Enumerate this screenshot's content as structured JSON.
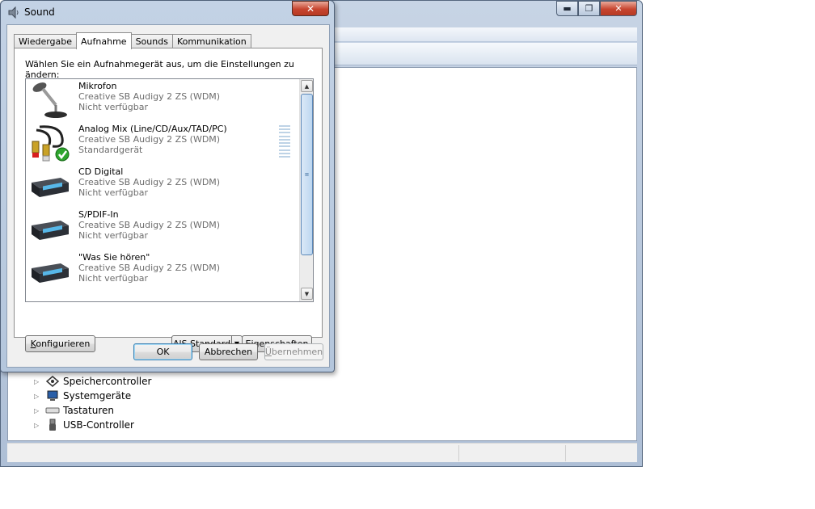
{
  "background_window": {
    "caption_buttons": {
      "minimize": "▬",
      "maximize": "❐",
      "close": "✕"
    },
    "tree_items": [
      {
        "label": "Speichercontroller",
        "icon": "storage-controller-icon"
      },
      {
        "label": "Systemgeräte",
        "icon": "system-devices-icon"
      },
      {
        "label": "Tastaturen",
        "icon": "keyboard-icon"
      },
      {
        "label": "USB-Controller",
        "icon": "usb-icon"
      }
    ]
  },
  "dialog": {
    "title": "Sound",
    "close_label": "✕",
    "tabs": [
      {
        "label": "Wiedergabe",
        "active": false
      },
      {
        "label": "Aufnahme",
        "active": true
      },
      {
        "label": "Sounds",
        "active": false
      },
      {
        "label": "Kommunikation",
        "active": false
      }
    ],
    "instruction": "Wählen Sie ein Aufnahmegerät aus, um die Einstellungen zu ändern:",
    "devices": [
      {
        "name": "Mikrofon",
        "driver": "Creative SB Audigy 2 ZS (WDM)",
        "status": "Nicht verfügbar",
        "icon": "microphone-icon"
      },
      {
        "name": "Analog Mix (Line/CD/Aux/TAD/PC)",
        "driver": "Creative SB Audigy 2 ZS (WDM)",
        "status": "Standardgerät",
        "icon": "cable-default-icon"
      },
      {
        "name": "CD Digital",
        "driver": "Creative SB Audigy 2 ZS (WDM)",
        "status": "Nicht verfügbar",
        "icon": "sound-device-icon"
      },
      {
        "name": "S/PDIF-In",
        "driver": "Creative SB Audigy 2 ZS (WDM)",
        "status": "Nicht verfügbar",
        "icon": "sound-device-icon"
      },
      {
        "name": "\"Was Sie hören\"",
        "driver": "Creative SB Audigy 2 ZS (WDM)",
        "status": "Nicht verfügbar",
        "icon": "sound-device-icon"
      }
    ],
    "buttons": {
      "configure_prefix": "",
      "configure_accel": "K",
      "configure_rest": "onfigurieren",
      "set_default_accel": "S",
      "set_default_prefix": "Al",
      "set_default_rest": " Standard",
      "properties_accel": "E",
      "properties_rest": "igenschaften",
      "ok": "OK",
      "cancel": "Abbrechen",
      "apply_accel": "Ü",
      "apply_rest": "bernehmen"
    }
  }
}
